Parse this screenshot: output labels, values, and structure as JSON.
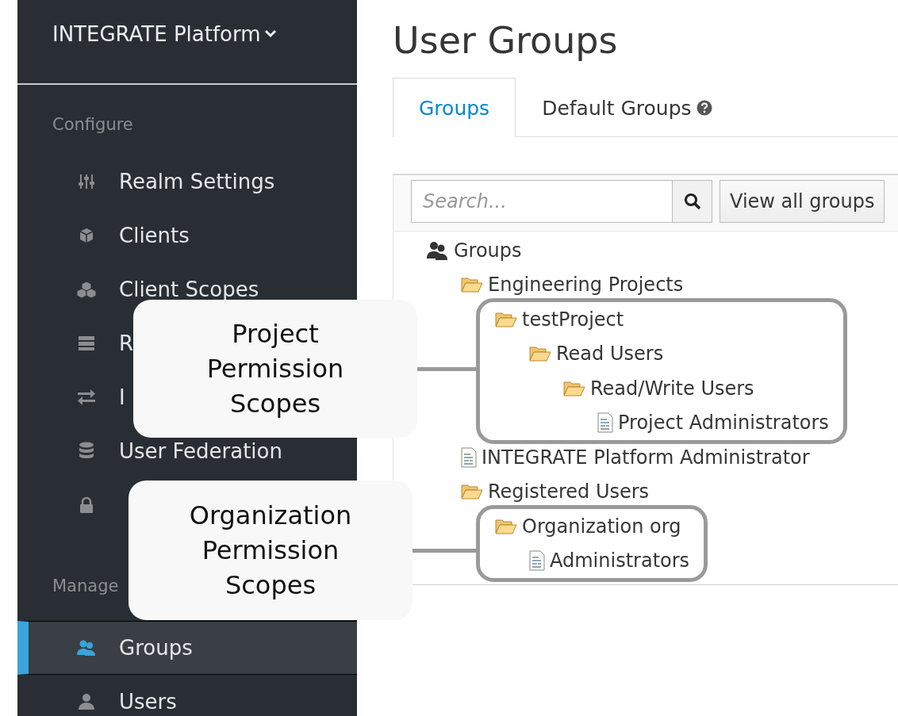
{
  "sidebar": {
    "realm": "INTEGRATE Platform",
    "sections": [
      {
        "title": "Configure",
        "items": [
          {
            "label": "Realm Settings",
            "kind": "sliders",
            "selected": false
          },
          {
            "label": "Clients",
            "kind": "cube",
            "selected": false
          },
          {
            "label": "Client Scopes",
            "kind": "cubes",
            "selected": false
          },
          {
            "label": "R",
            "kind": "server",
            "selected": false
          },
          {
            "label": "I",
            "kind": "exchange",
            "selected": false
          },
          {
            "label": "User Federation",
            "kind": "database",
            "selected": false
          },
          {
            "kind": "lock",
            "selected": false
          }
        ]
      },
      {
        "title": "Manage",
        "items": [
          {
            "label": "Groups",
            "kind": "groups",
            "selected": true
          },
          {
            "label": "Users",
            "kind": "user",
            "selected": false
          }
        ]
      }
    ]
  },
  "page": {
    "title": "User Groups",
    "tabs": [
      {
        "label": "Groups",
        "selected": true,
        "help": false
      },
      {
        "label": "Default Groups",
        "selected": false,
        "help": true
      }
    ],
    "search": {
      "placeholder": "Search..."
    },
    "view_all_button": "View all groups",
    "tree": [
      {
        "label": "Groups",
        "kind": "root",
        "framed": false,
        "children": [
          {
            "label": "Engineering Projects",
            "kind": "folder",
            "framed": false,
            "children": [
              {
                "label": "testProject",
                "kind": "folder",
                "framed": true,
                "children": [
                  {
                    "label": "Read Users",
                    "kind": "folder",
                    "framed": false,
                    "children": [
                      {
                        "label": "Read/Write Users",
                        "kind": "folder",
                        "framed": false,
                        "children": [
                          {
                            "label": "Project Administrators",
                            "kind": "document",
                            "framed": false
                          }
                        ]
                      }
                    ]
                  }
                ]
              }
            ]
          },
          {
            "label": "INTEGRATE Platform Administrator",
            "kind": "document",
            "framed": false
          },
          {
            "label": "Registered Users",
            "kind": "folder",
            "framed": false,
            "children": [
              {
                "label": "Organization org",
                "kind": "folder",
                "framed": true,
                "children": [
                  {
                    "label": "Administrators",
                    "kind": "document",
                    "framed": false
                  }
                ]
              }
            ]
          }
        ]
      }
    ]
  },
  "annotations": [
    {
      "text": "Project Permission Scopes"
    },
    {
      "text": "Organization Permission Scopes"
    }
  ]
}
